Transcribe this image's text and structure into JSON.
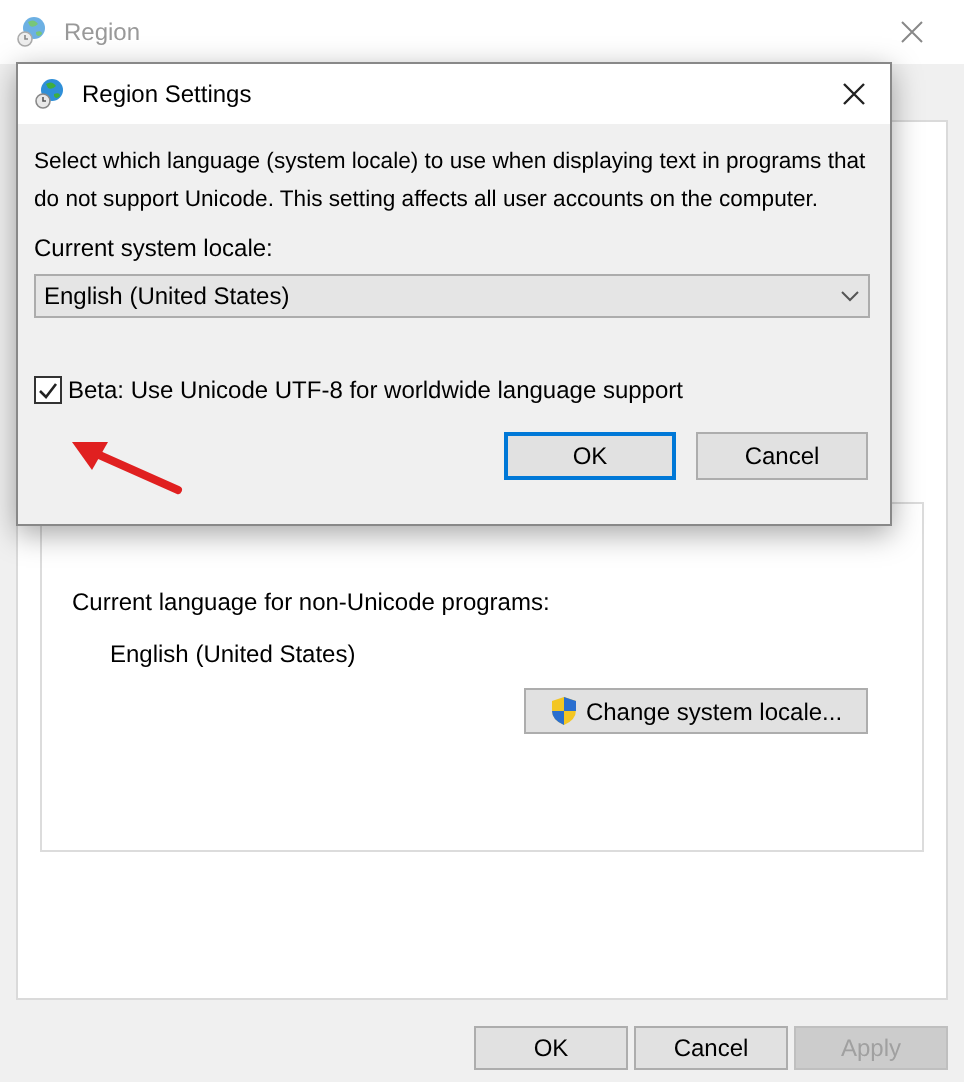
{
  "window": {
    "title": "Region"
  },
  "panel": {
    "label": "Current language for non-Unicode programs:",
    "value": "English (United States)",
    "button": "Change system locale..."
  },
  "buttons": [
    {
      "label": "OK",
      "disabled": false
    },
    {
      "label": "Cancel",
      "disabled": false
    },
    {
      "label": "Apply",
      "disabled": true
    }
  ],
  "dialog": {
    "title": "Region Settings",
    "description": "Select which language (system locale) to use when displaying text in programs that do not support Unicode. This setting affects all user accounts on the computer.",
    "locale_label": "Current system locale:",
    "locale_value": "English (United States)",
    "beta_option": {
      "label": "Beta: Use Unicode UTF-8 for worldwide language support",
      "checked": true
    },
    "buttons": [
      {
        "label": "OK",
        "default": true
      },
      {
        "label": "Cancel",
        "default": false
      }
    ]
  }
}
